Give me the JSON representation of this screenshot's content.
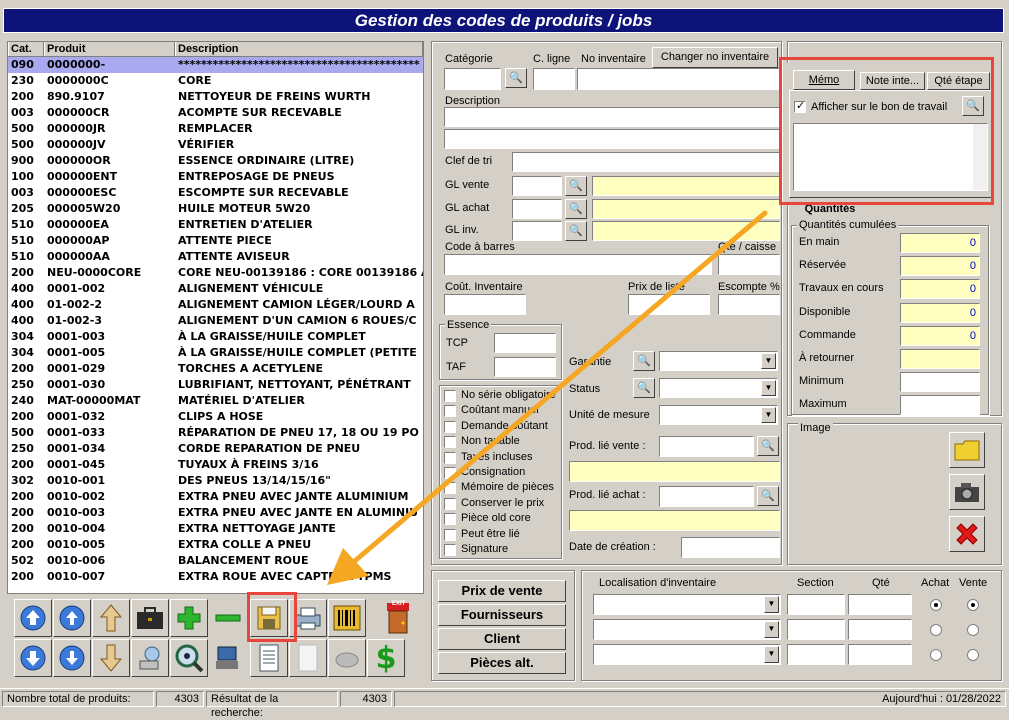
{
  "window": {
    "title": "Gestion des codes de produits / jobs"
  },
  "list": {
    "headers": [
      "Cat.",
      "Produit",
      "Description"
    ],
    "rows": [
      [
        "090",
        "0000000-",
        "******************************************"
      ],
      [
        "230",
        "0000000C",
        "CORE"
      ],
      [
        "200",
        "890.9107",
        "NETTOYEUR DE FREINS WURTH"
      ],
      [
        "003",
        "000000CR",
        "ACOMPTE SUR RECEVABLE"
      ],
      [
        "500",
        "000000JR",
        "REMPLACER"
      ],
      [
        "500",
        "000000JV",
        "VÉRIFIER"
      ],
      [
        "900",
        "000000OR",
        "ESSENCE ORDINAIRE (LITRE)"
      ],
      [
        "100",
        "000000ENT",
        "ENTREPOSAGE DE PNEUS"
      ],
      [
        "003",
        "000000ESC",
        "ESCOMPTE SUR RECEVABLE"
      ],
      [
        "205",
        "000005W20",
        "HUILE MOTEUR 5W20"
      ],
      [
        "510",
        "000000EA",
        "ENTRETIEN D'ATELIER"
      ],
      [
        "510",
        "000000AP",
        "ATTENTE PIECE"
      ],
      [
        "510",
        "000000AA",
        "ATTENTE AVISEUR"
      ],
      [
        "200",
        "NEU-0000CORE",
        "CORE NEU-00139186 : CORE 00139186 A"
      ],
      [
        "400",
        "0001-002",
        "ALIGNEMENT VÉHICULE"
      ],
      [
        "400",
        "01-002-2",
        "ALIGNEMENT CAMION LÉGER/LOURD A"
      ],
      [
        "400",
        "01-002-3",
        "ALIGNEMENT D'UN CAMION 6 ROUES/C"
      ],
      [
        "304",
        "0001-003",
        "À LA GRAISSE/HUILE COMPLET"
      ],
      [
        "304",
        "0001-005",
        "À LA GRAISSE/HUILE COMPLET (PETITE"
      ],
      [
        "200",
        "0001-029",
        "TORCHES A ACETYLENE"
      ],
      [
        "250",
        "0001-030",
        "LUBRIFIANT, NETTOYANT, PÉNÉTRANT"
      ],
      [
        "240",
        "MAT-00000MAT",
        "MATÉRIEL D'ATELIER"
      ],
      [
        "200",
        "0001-032",
        "CLIPS A HOSE"
      ],
      [
        "500",
        "0001-033",
        "RÉPARATION DE PNEU 17, 18 OU 19 PO"
      ],
      [
        "250",
        "0001-034",
        "CORDE REPARATION DE PNEU"
      ],
      [
        "200",
        "0001-045",
        "TUYAUX À FREINS 3/16"
      ],
      [
        "302",
        "0010-001",
        "DES PNEUS 13/14/15/16\""
      ],
      [
        "200",
        "0010-002",
        "EXTRA PNEU AVEC JANTE ALUMINIUM"
      ],
      [
        "200",
        "0010-003",
        "EXTRA PNEU AVEC JANTE EN ALUMINIU"
      ],
      [
        "200",
        "0010-004",
        "EXTRA NETTOYAGE JANTE"
      ],
      [
        "200",
        "0010-005",
        "EXTRA COLLE A PNEU"
      ],
      [
        "502",
        "0010-006",
        "BALANCEMENT ROUE"
      ],
      [
        "200",
        "0010-007",
        "EXTRA ROUE AVEC CAPTEUR TPMS"
      ]
    ]
  },
  "form": {
    "categorie": "Catégorie",
    "c_ligne": "C. ligne",
    "no_inventaire": "No inventaire",
    "changer_btn": "Changer no inventaire",
    "description": "Description",
    "clef_tri": "Clef de tri",
    "gl_vente": "GL vente",
    "gl_achat": "GL achat",
    "gl_inv": "GL inv.",
    "code_barres": "Code à barres",
    "qte_caisse": "Qté / caisse",
    "cout_inv": "Coût. Inventaire",
    "prix_liste": "Prix de liste",
    "escompte": "Escompte %",
    "essence": "Essence",
    "tcp": "TCP",
    "taf": "TAF",
    "garantie": "Garantie",
    "status": "Status",
    "unite": "Unité de mesure",
    "prod_lie_vente": "Prod. lié vente :",
    "prod_lie_achat": "Prod. lié achat :",
    "date_creation": "Date de création :"
  },
  "checkboxes": [
    "No série obligatoire",
    "Coûtant manuel",
    "Demande coûtant",
    "Non taxable",
    "Taxes incluses",
    "Consignation",
    "Mémoire de pièces",
    "Conserver le prix",
    "Pièce old core",
    "Peut être lié",
    "Signature"
  ],
  "memo": {
    "tabs": [
      "Mémo",
      "Note inte...",
      "Qté étape"
    ],
    "afficher": "Afficher sur le bon de travail"
  },
  "quantites": {
    "tab": "Quantités",
    "group": "Quantités cumulées",
    "rows": [
      {
        "label": "En main",
        "value": "0"
      },
      {
        "label": "Réservée",
        "value": "0"
      },
      {
        "label": "Travaux en cours",
        "value": "0"
      },
      {
        "label": "Disponible",
        "value": "0"
      },
      {
        "label": "Commande",
        "value": "0"
      },
      {
        "label": "À retourner",
        "value": ""
      },
      {
        "label": "Minimum",
        "value": ""
      },
      {
        "label": "Maximum",
        "value": ""
      }
    ]
  },
  "image": {
    "label": "Image"
  },
  "bottom_buttons": [
    "Prix de vente",
    "Fournisseurs",
    "Client",
    "Pièces alt."
  ],
  "location": {
    "headers": [
      "Localisation d'inventaire",
      "Section",
      "Qté",
      "Achat",
      "Vente"
    ]
  },
  "status": {
    "total_label": "Nombre total de produits:",
    "total": "4303",
    "result_label": "Résultat de la recherche:",
    "result": "4303",
    "today": "Aujourd'hui : 01/28/2022"
  },
  "toolbar": {
    "exit": "EXIT"
  },
  "annotation_color": "#e8453c",
  "arrow_color": "#f5a623"
}
